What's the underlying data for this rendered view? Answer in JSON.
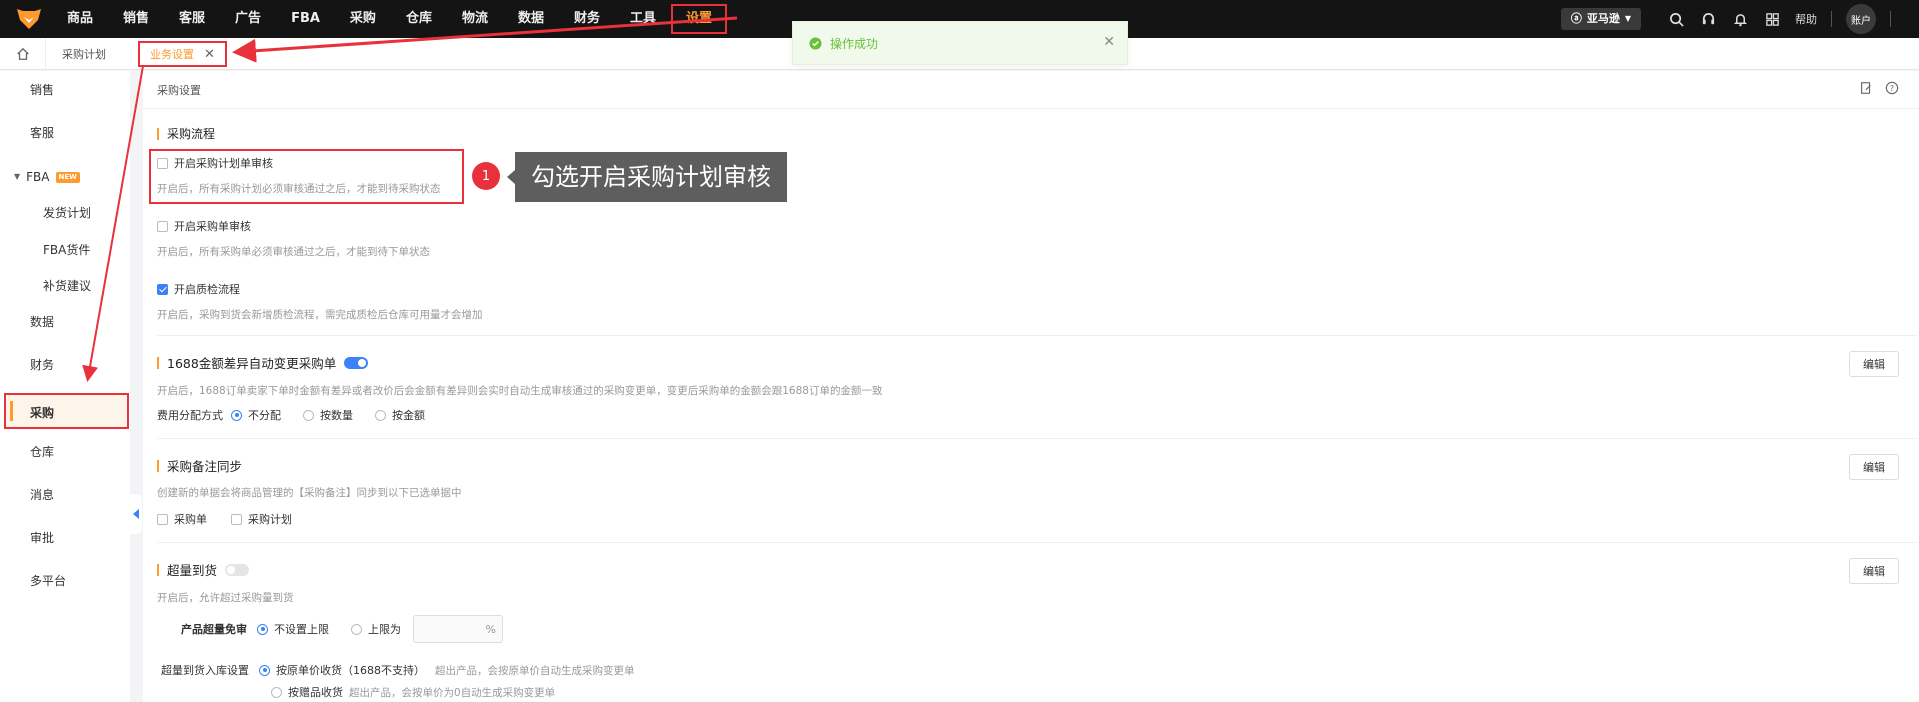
{
  "nav": {
    "items": [
      "商品",
      "销售",
      "客服",
      "广告",
      "FBA",
      "采购",
      "仓库",
      "物流",
      "数据",
      "财务",
      "工具",
      "设置"
    ],
    "active_label": "设置"
  },
  "topbar": {
    "marketplace": "亚马逊",
    "help": "帮助",
    "account": "账户"
  },
  "tabs": {
    "crumb": "采购计划",
    "active_tab": "业务设置"
  },
  "toast": {
    "message": "操作成功"
  },
  "sidebar": {
    "items": [
      "销售",
      "客服",
      "FBA",
      "发货计划",
      "FBA货件",
      "补货建议",
      "数据",
      "财务",
      "采购",
      "仓库",
      "消息",
      "审批",
      "多平台"
    ],
    "new_badge": "NEW"
  },
  "content": {
    "header": "采购设置",
    "flow": {
      "title": "采购流程",
      "plan_review_label": "开启采购计划单审核",
      "plan_review_desc": "开启后，所有采购计划必须审核通过之后，才能到待采购状态",
      "order_review_label": "开启采购单审核",
      "order_review_desc": "开启后，所有采购单必须审核通过之后，才能到待下单状态",
      "qc_label": "开启质检流程",
      "qc_desc": "开启后，采购到货会新增质检流程，需完成质检后仓库可用量才会增加"
    },
    "diff": {
      "title": "1688金额差异自动变更采购单",
      "desc": "开启后，1688订单卖家下单时金额有差异或者改价后会金额有差异则会实时自动生成审核通过的采购变更单，变更后采购单的金额会跟1688订单的金额一致",
      "alloc_label": "费用分配方式",
      "options": [
        "不分配",
        "按数量",
        "按金额"
      ],
      "edit": "编辑"
    },
    "remark": {
      "title": "采购备注同步",
      "desc": "创建新的单据会将商品管理的【采购备注】同步到以下已选单据中",
      "options": [
        "采购单",
        "采购计划"
      ],
      "edit": "编辑"
    },
    "over": {
      "title": "超量到货",
      "desc": "开启后，允许超过采购量到货",
      "exempt_label": "产品超量免审",
      "exempt_options": [
        "不设置上限",
        "上限为"
      ],
      "percent": "%",
      "inbound_label": "超量到货入库设置",
      "opt1": "按原单价收货（1688不支持）",
      "opt1_desc": "超出产品，会按原单价自动生成采购变更单",
      "opt2": "按赠品收货",
      "opt2_desc": "超出产品，会按单价为0自动生成采购变更单",
      "edit": "编辑"
    }
  },
  "callout": {
    "number": "1",
    "text": "勾选开启采购计划审核"
  },
  "colors": {
    "accent": "#ff9a2e",
    "highlight": "#e8313a",
    "primary": "#3b82f6",
    "success": "#67c23a"
  }
}
